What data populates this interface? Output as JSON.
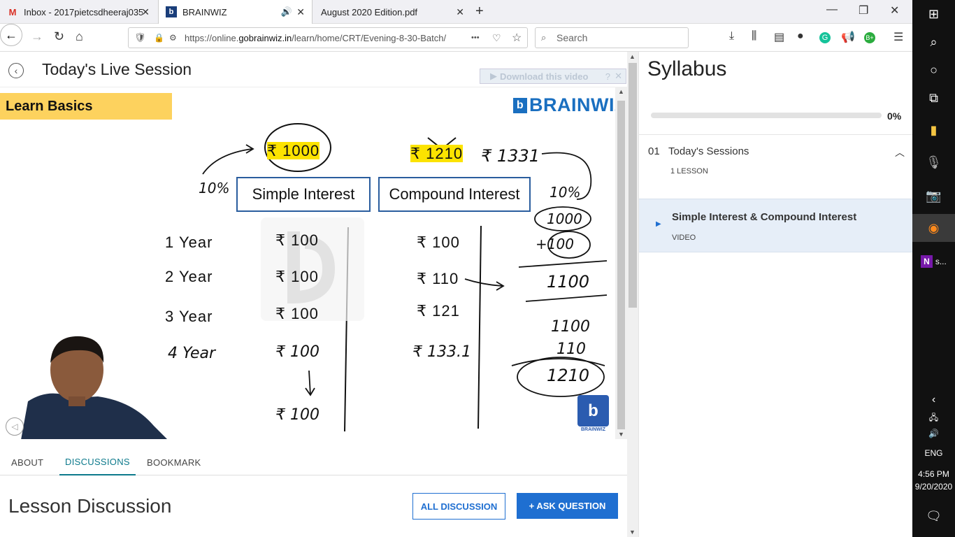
{
  "browser": {
    "tabs": [
      {
        "label": "Inbox - 2017pietcsdheeraj035@",
        "icon": "gmail-icon",
        "active": false
      },
      {
        "label": "BRAINWIZ",
        "icon": "brainwiz-icon",
        "active": true
      },
      {
        "label": "August 2020 Edition.pdf",
        "icon": "",
        "active": false
      }
    ],
    "url_prefix": "https://online.",
    "url_domain": "gobrainwiz.in",
    "url_suffix": "/learn/home/CRT/Evening-8-30-Batch/",
    "url_more": "•••",
    "search_placeholder": "Search"
  },
  "page": {
    "session_title": "Today's Live Session",
    "download_label": "Download this video",
    "tabs": [
      "ABOUT",
      "DISCUSSIONS",
      "BOOKMARK"
    ],
    "active_tab": "DISCUSSIONS",
    "discussion_title": "Lesson Discussion",
    "all_discussion_label": "ALL DISCUSSION",
    "ask_question_label": "+ ASK QUESTION"
  },
  "video": {
    "banner": "Learn Basics",
    "brand": "BRAINWIZ",
    "simple_interest_label": "Simple Interest",
    "compound_interest_label": "Compound Interest",
    "principal": "₹ 1000",
    "rows": [
      {
        "year": "1 Year",
        "si": "₹ 100",
        "ci": "₹ 100"
      },
      {
        "year": "2 Year",
        "si": "₹ 100",
        "ci": "₹ 110"
      },
      {
        "year": "3 Year",
        "si": "₹ 100",
        "ci": "₹ 121"
      },
      {
        "year": "4 Year",
        "si": "₹ 100",
        "ci": "₹ 133.1"
      }
    ],
    "si_total": "₹ 100",
    "ci_struck": "₹ 1210",
    "ci_new": "₹ 1331",
    "rate_left": "10%",
    "rate_right": "10%",
    "calc": [
      "1000",
      "+100",
      "1100",
      "1100",
      "110",
      "1210"
    ],
    "watermark": "BRAINWIZ"
  },
  "syllabus": {
    "title": "Syllabus",
    "progress_pct": "0%",
    "progress_value": 0,
    "section_num": "01",
    "section_name": "Today's Sessions",
    "section_meta": "1 LESSON",
    "lesson_name": "Simple Interest & Compound Interest",
    "lesson_kind": "VIDEO"
  },
  "taskbar": {
    "lang": "ENG",
    "time": "4:56 PM",
    "date": "9/20/2020",
    "onenote_label": "s..."
  }
}
